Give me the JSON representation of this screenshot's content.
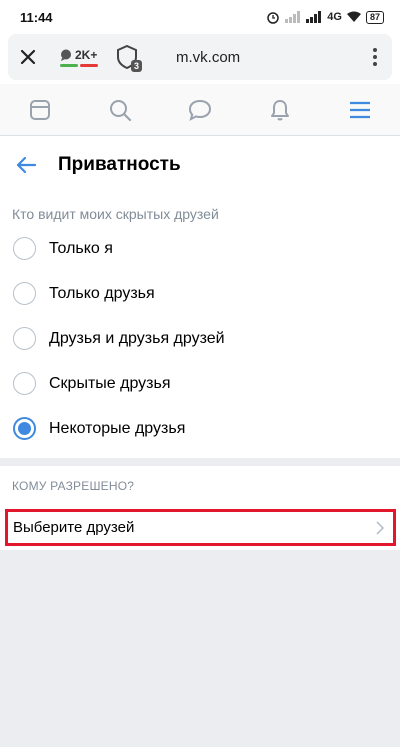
{
  "status_bar": {
    "time": "11:44",
    "network": "4G",
    "battery": "87"
  },
  "browser": {
    "url": "m.vk.com",
    "counter": "2K+",
    "shield_count": "3"
  },
  "page": {
    "title": "Приватность",
    "section_caption": "Кто видит моих скрытых друзей",
    "options": [
      {
        "label": "Только я",
        "checked": false
      },
      {
        "label": "Только друзья",
        "checked": false
      },
      {
        "label": "Друзья и друзья друзей",
        "checked": false
      },
      {
        "label": "Скрытые друзья",
        "checked": false
      },
      {
        "label": "Некоторые друзья",
        "checked": true
      }
    ],
    "allowed_caption": "КОМУ РАЗРЕШЕНО?",
    "select_friends": "Выберите друзей"
  },
  "colors": {
    "accent": "#3f8ae0",
    "highlight": "#e2162c",
    "caption": "#818c99",
    "background": "#ebedf0"
  },
  "icons": [
    "close-icon",
    "chat-bubble-icon",
    "shield-icon",
    "menu-dots-icon",
    "calendar-icon",
    "search-icon",
    "message-icon",
    "bell-icon",
    "hamburger-icon",
    "back-arrow-icon",
    "chevron-right-icon"
  ]
}
